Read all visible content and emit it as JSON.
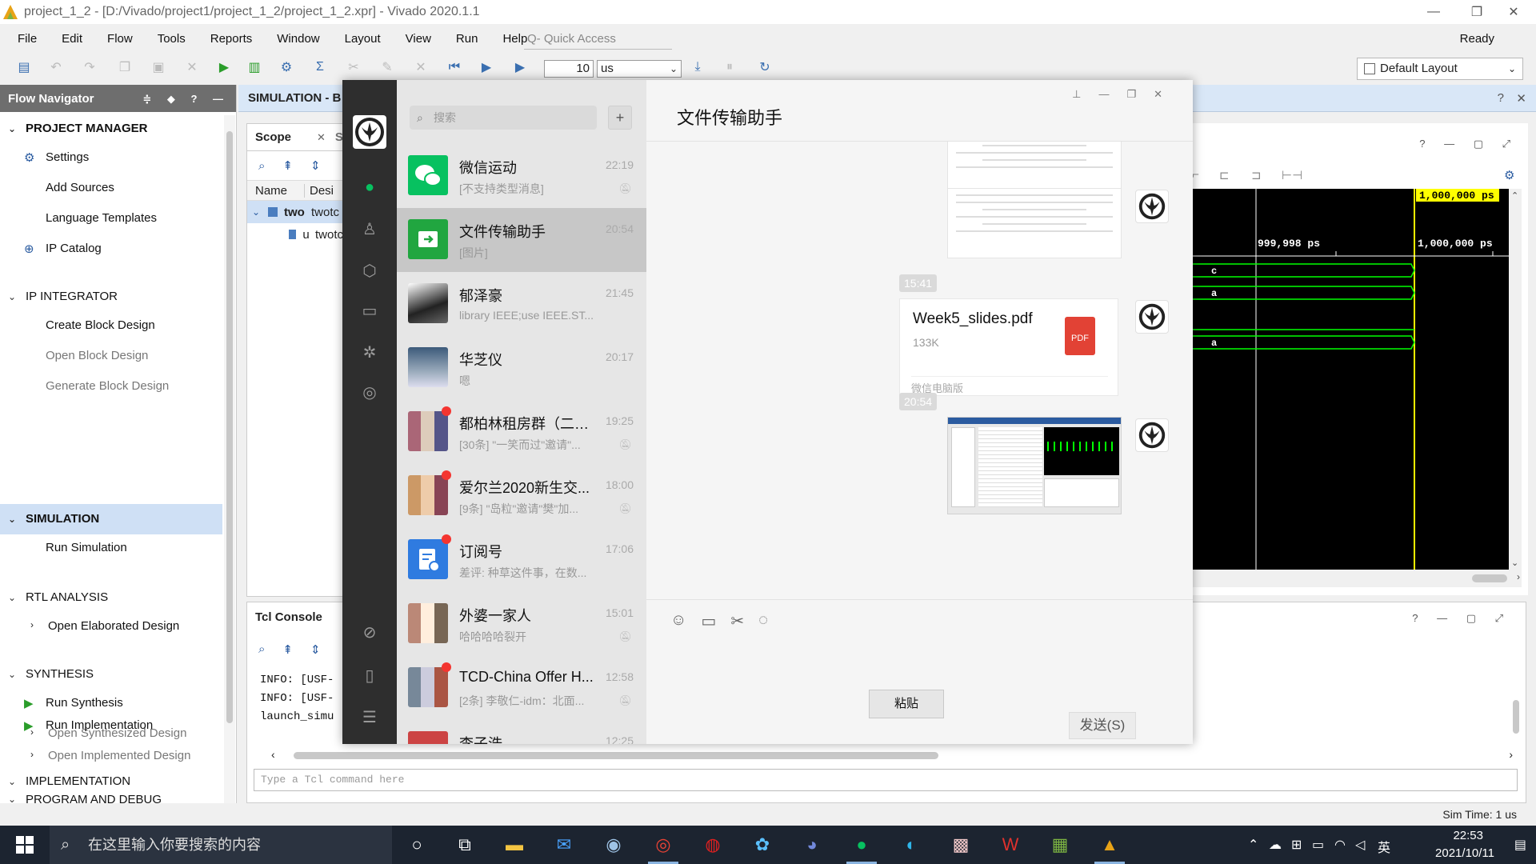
{
  "vivado": {
    "title": "project_1_2 - [D:/Vivado/project1/project_1_2/project_1_2.xpr] - Vivado 2020.1.1",
    "menu": [
      "File",
      "Edit",
      "Flow",
      "Tools",
      "Reports",
      "Window",
      "Layout",
      "View",
      "Run",
      "Help"
    ],
    "quick_access_placeholder": "Q- Quick Access",
    "status": "Ready",
    "toolbar": {
      "sim_time_value": "10",
      "sim_time_unit": "us"
    },
    "layout_select": "Default Layout",
    "flow_navigator": {
      "title": "Flow Navigator",
      "sections": [
        {
          "label": "PROJECT MANAGER",
          "items": [
            "Settings",
            "Add Sources",
            "Language Templates",
            "IP Catalog"
          ]
        },
        {
          "label": "IP INTEGRATOR",
          "items": [
            "Create Block Design",
            "Open Block Design",
            "Generate Block Design"
          ]
        },
        {
          "label": "SIMULATION",
          "items": [
            "Run Simulation"
          ]
        },
        {
          "label": "RTL ANALYSIS",
          "items": [
            "Open Elaborated Design"
          ]
        },
        {
          "label": "SYNTHESIS",
          "items": [
            "Run Synthesis",
            "Open Synthesized Design"
          ]
        },
        {
          "label": "IMPLEMENTATION",
          "items": [
            "Run Implementation",
            "Open Implemented Design"
          ]
        },
        {
          "label": "PROGRAM AND DEBUG",
          "items": []
        }
      ]
    },
    "sim_panel_title": "SIMULATION - B",
    "scope": {
      "tab": "Scope",
      "tab2": "So",
      "columns": [
        "Name",
        "Desi"
      ],
      "rows": [
        {
          "name": "two",
          "design": "twotc"
        },
        {
          "name": "u",
          "design": "twotc"
        }
      ]
    },
    "wave": {
      "cursor_label": "1,000,000 ps",
      "ruler": [
        "999,998 ps",
        "1,000,000 ps"
      ],
      "signals": [
        "c",
        "a",
        "",
        "a"
      ]
    },
    "tcl": {
      "title": "Tcl Console",
      "log": [
        "INFO: [USF-",
        "INFO: [USF-",
        "launch_simu"
      ],
      "input_placeholder": "Type a Tcl command here"
    },
    "sim_time_status": "Sim Time: 1 us"
  },
  "wechat": {
    "search_placeholder": "搜索",
    "chat_title": "文件传输助手",
    "chats": [
      {
        "name": "微信运动",
        "time": "22:19",
        "preview": "[不支持类型消息]",
        "muted": true,
        "unread": false
      },
      {
        "name": "文件传输助手",
        "time": "20:54",
        "preview": "[图片]",
        "muted": false,
        "unread": false
      },
      {
        "name": "郁泽豪",
        "time": "21:45",
        "preview": "library IEEE;use IEEE.ST...",
        "muted": false,
        "unread": false
      },
      {
        "name": "华芝仪",
        "time": "20:17",
        "preview": "嗯",
        "muted": false,
        "unread": false
      },
      {
        "name": "都柏林租房群（二）...",
        "time": "19:25",
        "preview": "[30条] \"一笑而过\"邀请\"...",
        "muted": true,
        "unread": true
      },
      {
        "name": "爱尔兰2020新生交...",
        "time": "18:00",
        "preview": "[9条] \"岛粒\"邀请\"樊\"加...",
        "muted": true,
        "unread": true
      },
      {
        "name": "订阅号",
        "time": "17:06",
        "preview": "差评: 种草这件事，在数...",
        "muted": false,
        "unread": true
      },
      {
        "name": "外婆一家人",
        "time": "15:01",
        "preview": "哈哈哈哈裂开",
        "muted": true,
        "unread": false
      },
      {
        "name": "TCD-China Offer H...",
        "time": "12:58",
        "preview": "[2条] 李敬仁-idm：北面...",
        "muted": true,
        "unread": true
      },
      {
        "name": "李子浩",
        "time": "12:25",
        "preview": "",
        "muted": false,
        "unread": false
      }
    ],
    "messages": {
      "time1": "15:41",
      "file": {
        "name": "Week5_slides.pdf",
        "size": "133K",
        "badge": "PDF",
        "source": "微信电脑版"
      },
      "time2": "20:54"
    },
    "paste_label": "粘贴",
    "send_label": "发送(S)"
  },
  "taskbar": {
    "search_placeholder": "在这里输入你要搜索的内容",
    "ime": "英",
    "clock_time": "22:53",
    "clock_date": "2021/10/11"
  },
  "colors": {
    "wechat_green": "#07c160",
    "vivado_header": "#6e6e6e",
    "selection_blue": "#cfe0f5",
    "wave_green": "#00ff00",
    "cursor_yellow": "#ffff00"
  }
}
